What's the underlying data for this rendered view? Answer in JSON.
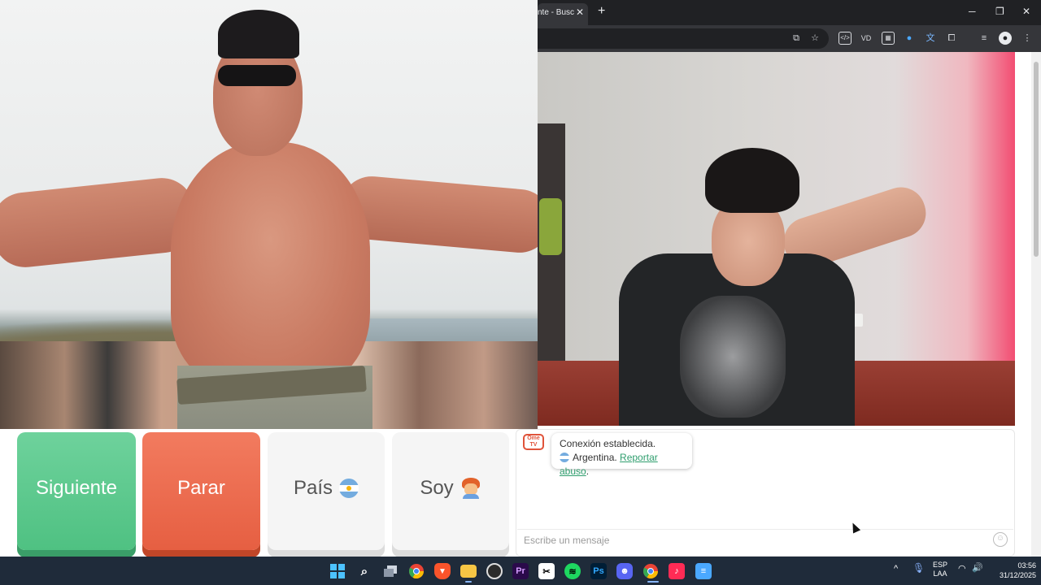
{
  "browser": {
    "tab_title": "nte - Busc",
    "new_tab": "+",
    "window_controls": {
      "minimize": "─",
      "maximize": "❐",
      "close": "✕"
    },
    "extensions": [
      "install-icon",
      "star-icon",
      "dev-ext-icon",
      "vd-ext-icon",
      "grid-ext-icon",
      "blue-ext-icon",
      "translate-ext-icon",
      "puzzle-icon",
      "queue-icon",
      "profile-icon",
      "menu-icon"
    ],
    "ext_labels": {
      "vd": "VD",
      "dev": "</>"
    }
  },
  "buttons": {
    "next": "Siguiente",
    "stop": "Parar",
    "country": "País",
    "soy": "Soy"
  },
  "chat": {
    "logo_text": "Ome TV",
    "status": "Conexión establecida.",
    "country": "Argentina.",
    "report": "Reportar abuso",
    "report_suffix": ".",
    "input_placeholder": "Escribe un mensaje"
  },
  "taskbar": {
    "apps": [
      "windows-start",
      "search",
      "task-view",
      "chrome",
      "brave",
      "file-explorer",
      "obs",
      "premiere",
      "capcut",
      "spotify",
      "photoshop",
      "discord",
      "chrome-active",
      "tiktok",
      "notepad"
    ],
    "labels": {
      "premiere": "Pr",
      "photoshop": "Ps"
    },
    "lang_top": "ESP",
    "lang_bottom": "LAA",
    "time": "03:56",
    "date": "31/12/2025",
    "tray_chevron": "^"
  },
  "colors": {
    "next_green": "#4fc182",
    "stop_orange": "#e65f42",
    "link_green": "#2f9e6e",
    "taskbar": "#1f2b3a",
    "chrome_dark": "#202124"
  }
}
